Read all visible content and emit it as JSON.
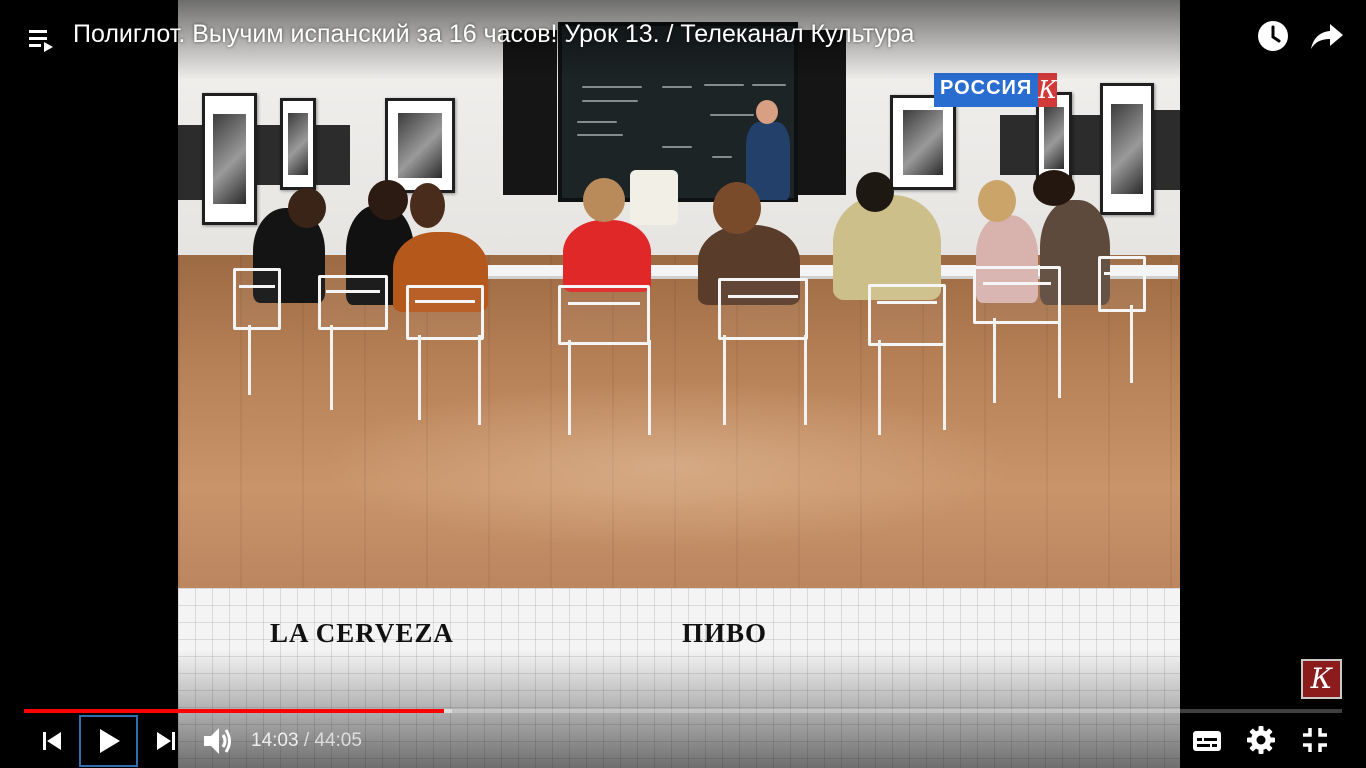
{
  "video": {
    "title": "Полиглот. Выучим испанский за 16 часов! Урок 13. / Телеканал Культура",
    "channel_logo_text": "РОССИЯ",
    "channel_logo_letter": "К",
    "watermark_letter": "К",
    "caption": {
      "spanish": "LA CERVEZA",
      "russian": "ПИВО"
    }
  },
  "top_controls": {
    "playlist_icon": "playlist-icon",
    "watch_later_icon": "clock-icon",
    "share_icon": "share-icon"
  },
  "player": {
    "current_time": "14:03",
    "separator": "/",
    "duration": "44:05",
    "progress_fraction": 0.319,
    "buffered_fraction": 0.325,
    "played_color": "#ff0000",
    "state": "paused",
    "icons": {
      "previous": "skip-previous-icon",
      "play": "play-icon",
      "next": "skip-next-icon",
      "volume": "volume-icon",
      "captions": "subtitles-icon",
      "settings": "gear-icon",
      "exit_fullscreen": "exit-fullscreen-icon"
    }
  }
}
